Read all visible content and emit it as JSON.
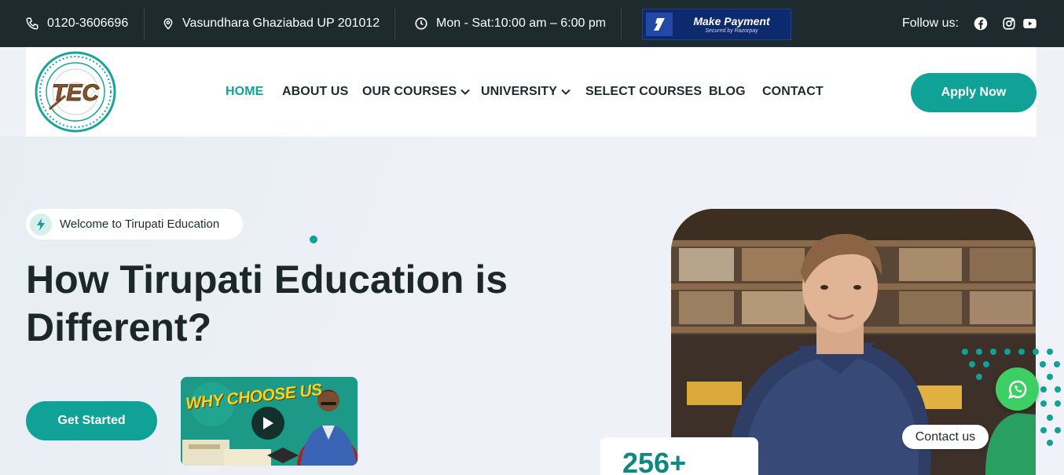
{
  "topbar": {
    "phone": "0120-3606696",
    "address": "Vasundhara Ghaziabad UP 201012",
    "hours": "Mon - Sat:10:00 am – 6:00 pm",
    "payment": {
      "title": "Make Payment",
      "subtitle": "Secured by Razorpay"
    },
    "follow_label": "Follow us:",
    "social_icons": [
      "facebook-icon",
      "instagram-icon",
      "youtube-icon"
    ]
  },
  "logo": {
    "text": "TEC"
  },
  "nav": {
    "items": [
      {
        "label": "HOME",
        "active": true
      },
      {
        "label": "ABOUT US"
      },
      {
        "label": "OUR COURSES",
        "dropdown": true
      },
      {
        "label": "UNIVERSITY",
        "dropdown": true
      },
      {
        "label": "SELECT COURSES"
      },
      {
        "label": "BLOG"
      },
      {
        "label": "CONTACT"
      }
    ],
    "apply_label": "Apply Now"
  },
  "hero": {
    "welcome": "Welcome to Tirupati Education",
    "headline_line1": "How Tirupati Education is",
    "headline_line2": "Different?",
    "cta_label": "Get Started",
    "video_title": "WHY CHOOSE US"
  },
  "stat": {
    "value": "256+"
  },
  "contact_widget": {
    "label": "Contact us"
  },
  "colors": {
    "accent": "#10a197",
    "topbar": "#1d2a2e",
    "whatsapp": "#3dcf63"
  }
}
